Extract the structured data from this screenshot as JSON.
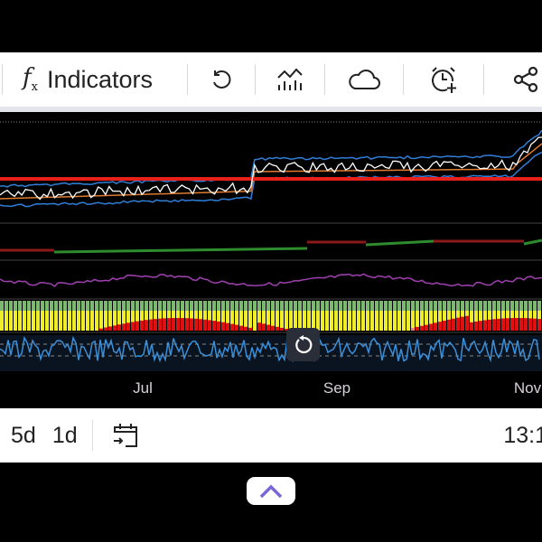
{
  "toolbar": {
    "indicators_label": "Indicators",
    "icons": [
      "function-icon",
      "undo-icon",
      "chart-type-icon",
      "cloud-icon",
      "alarm-add-icon",
      "share-icon"
    ]
  },
  "chart": {
    "x_labels": [
      "Jul",
      "Sep",
      "Nov"
    ],
    "colors": {
      "price": "#ffffff",
      "ma_red": "#e8201c",
      "band": "#2f7fd8",
      "ma_orange": "#e07a30",
      "step_green": "#2e8b2e",
      "step_red": "#8b1a1a",
      "purple": "#a040b0",
      "osc": "#3a8fd8"
    }
  },
  "bottombar": {
    "range_5d": "5d",
    "range_1d": "1d",
    "time": "13:1"
  }
}
